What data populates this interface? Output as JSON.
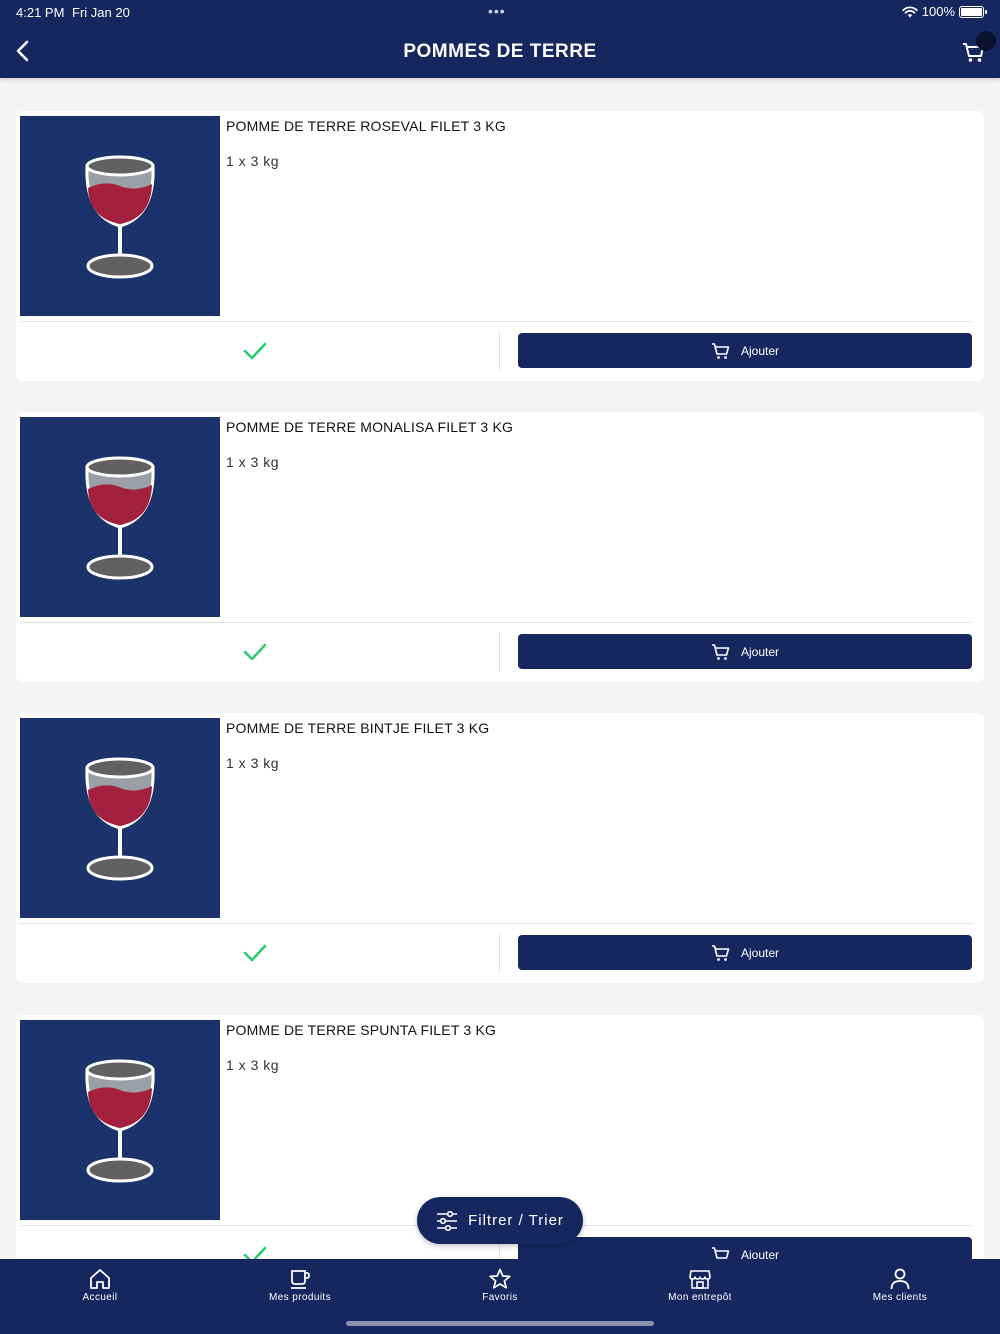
{
  "status_bar": {
    "time": "4:21 PM",
    "date": "Fri Jan 20",
    "battery": "100%"
  },
  "header": {
    "title": "POMMES DE TERRE"
  },
  "products": [
    {
      "name": "POMME DE TERRE ROSEVAL FILET 3 KG",
      "packaging": "1 x 3 kg",
      "add_label": "Ajouter"
    },
    {
      "name": "POMME DE TERRE MONALISA FILET 3 KG",
      "packaging": "1 x 3 kg",
      "add_label": "Ajouter"
    },
    {
      "name": "POMME DE TERRE BINTJE FILET 3 KG",
      "packaging": "1 x 3 kg",
      "add_label": "Ajouter"
    },
    {
      "name": "POMME DE TERRE SPUNTA FILET 3 KG",
      "packaging": "1 x 3 kg",
      "add_label": "Ajouter"
    }
  ],
  "filter_button": {
    "label": "Filtrer / Trier"
  },
  "tabs": [
    {
      "label": "Accueil",
      "icon": "home-icon"
    },
    {
      "label": "Mes produits",
      "icon": "cup-icon"
    },
    {
      "label": "Favoris",
      "icon": "star-icon"
    },
    {
      "label": "Mon entrepôt",
      "icon": "store-icon"
    },
    {
      "label": "Mes clients",
      "icon": "user-icon"
    }
  ],
  "colors": {
    "primary": "#16275f",
    "thumb_bg": "#1b326a",
    "check": "#2ecc71",
    "background": "#f4f4f4"
  }
}
